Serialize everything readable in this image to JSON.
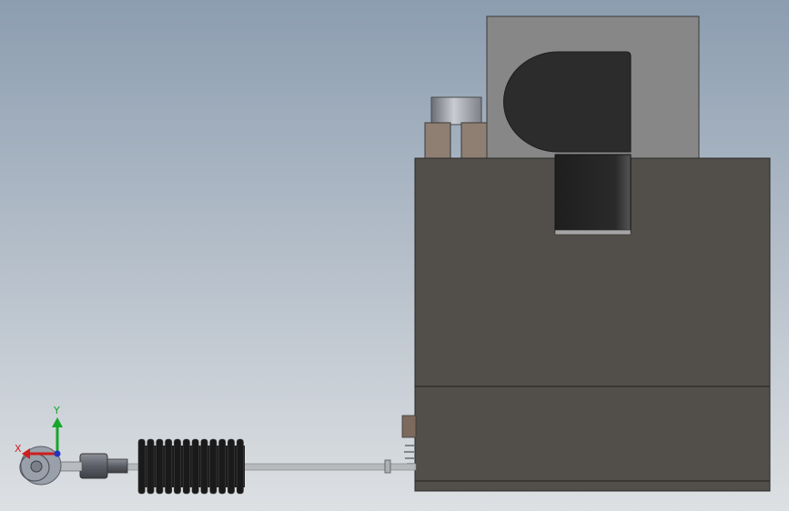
{
  "viewport": {
    "background_top": "#8c9db0",
    "background_bottom": "#dde0e3"
  },
  "model": {
    "body_color": "#524f4a",
    "cover_color": "#878787",
    "knob_color": "#2c2c2c",
    "stud_color": "#8f7f72",
    "bellows_color": "#1a1a1a",
    "shaft_color": "#b7babd"
  },
  "triad": {
    "x_label": "X",
    "y_label": "Y",
    "x_color": "#cc1f1f",
    "y_color": "#18a52a",
    "z_color": "#1f36c4"
  }
}
